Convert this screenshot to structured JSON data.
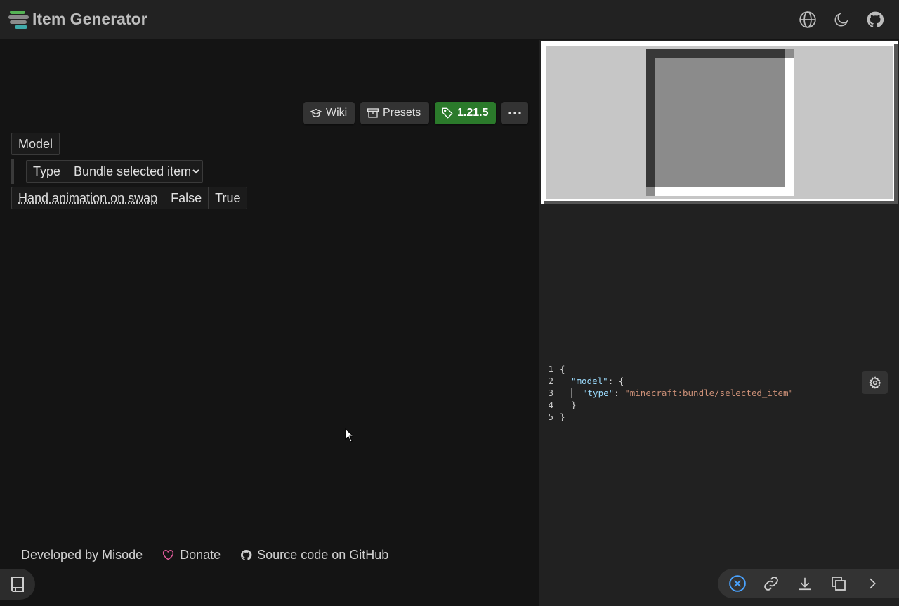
{
  "header": {
    "title": "Item Generator",
    "logo_colors": [
      "#55b355",
      "#8a8a8a",
      "#3fa9a9"
    ],
    "icons": [
      "globe-icon",
      "moon-icon",
      "github-icon"
    ]
  },
  "toolbar": {
    "wiki_label": "Wiki",
    "presets_label": "Presets",
    "version_label": "1.21.5",
    "version_color": "#2b7a2b",
    "more_icon": "more-icon"
  },
  "tree": {
    "model_label": "Model",
    "type_label": "Type",
    "type_value": "Bundle selected item",
    "hand_anim_label": "Hand animation on swap",
    "false_label": "False",
    "true_label": "True"
  },
  "footer": {
    "developed_by": "Developed by",
    "developer_link": "Misode",
    "donate_link": "Donate",
    "source_text": "Source code on",
    "github_link": "GitHub"
  },
  "code": {
    "line_numbers": [
      "1",
      "2",
      "3",
      "4",
      "5"
    ],
    "open_brace": "{",
    "model_key": "\"model\"",
    "colon_open": ": {",
    "type_key": "\"type\"",
    "colon": ": ",
    "type_value": "\"minecraft:bundle/selected_item\"",
    "close_inner": "}",
    "close_outer": "}"
  },
  "actions": [
    "close-circle-icon",
    "link-icon",
    "download-icon",
    "copy-icon",
    "chevron-right-icon"
  ]
}
